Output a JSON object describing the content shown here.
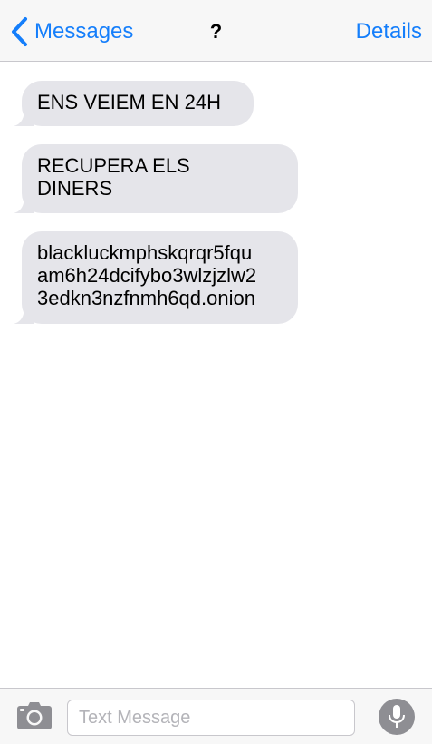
{
  "colors": {
    "accent": "#147efb",
    "bubble_incoming": "#e5e5ea",
    "navbar_background": "#f7f7f7",
    "icon_gray": "#8e8e93"
  },
  "navbar": {
    "back_label": "Messages",
    "back_icon": "chevron-left-icon",
    "title": "?",
    "details_label": "Details"
  },
  "messages": [
    {
      "direction": "incoming",
      "text": "ENS VEIEM EN 24H"
    },
    {
      "direction": "incoming",
      "text": "RECUPERA ELS\nDINERS"
    },
    {
      "direction": "incoming",
      "text": "blackluckmphskqrqr5fqu\nam6h24dcifybo3wlzjzlw2\n3edkn3nzfnmh6qd.onion"
    }
  ],
  "input_bar": {
    "camera_icon": "camera-icon",
    "placeholder": "Text Message",
    "value": "",
    "mic_icon": "microphone-icon"
  }
}
